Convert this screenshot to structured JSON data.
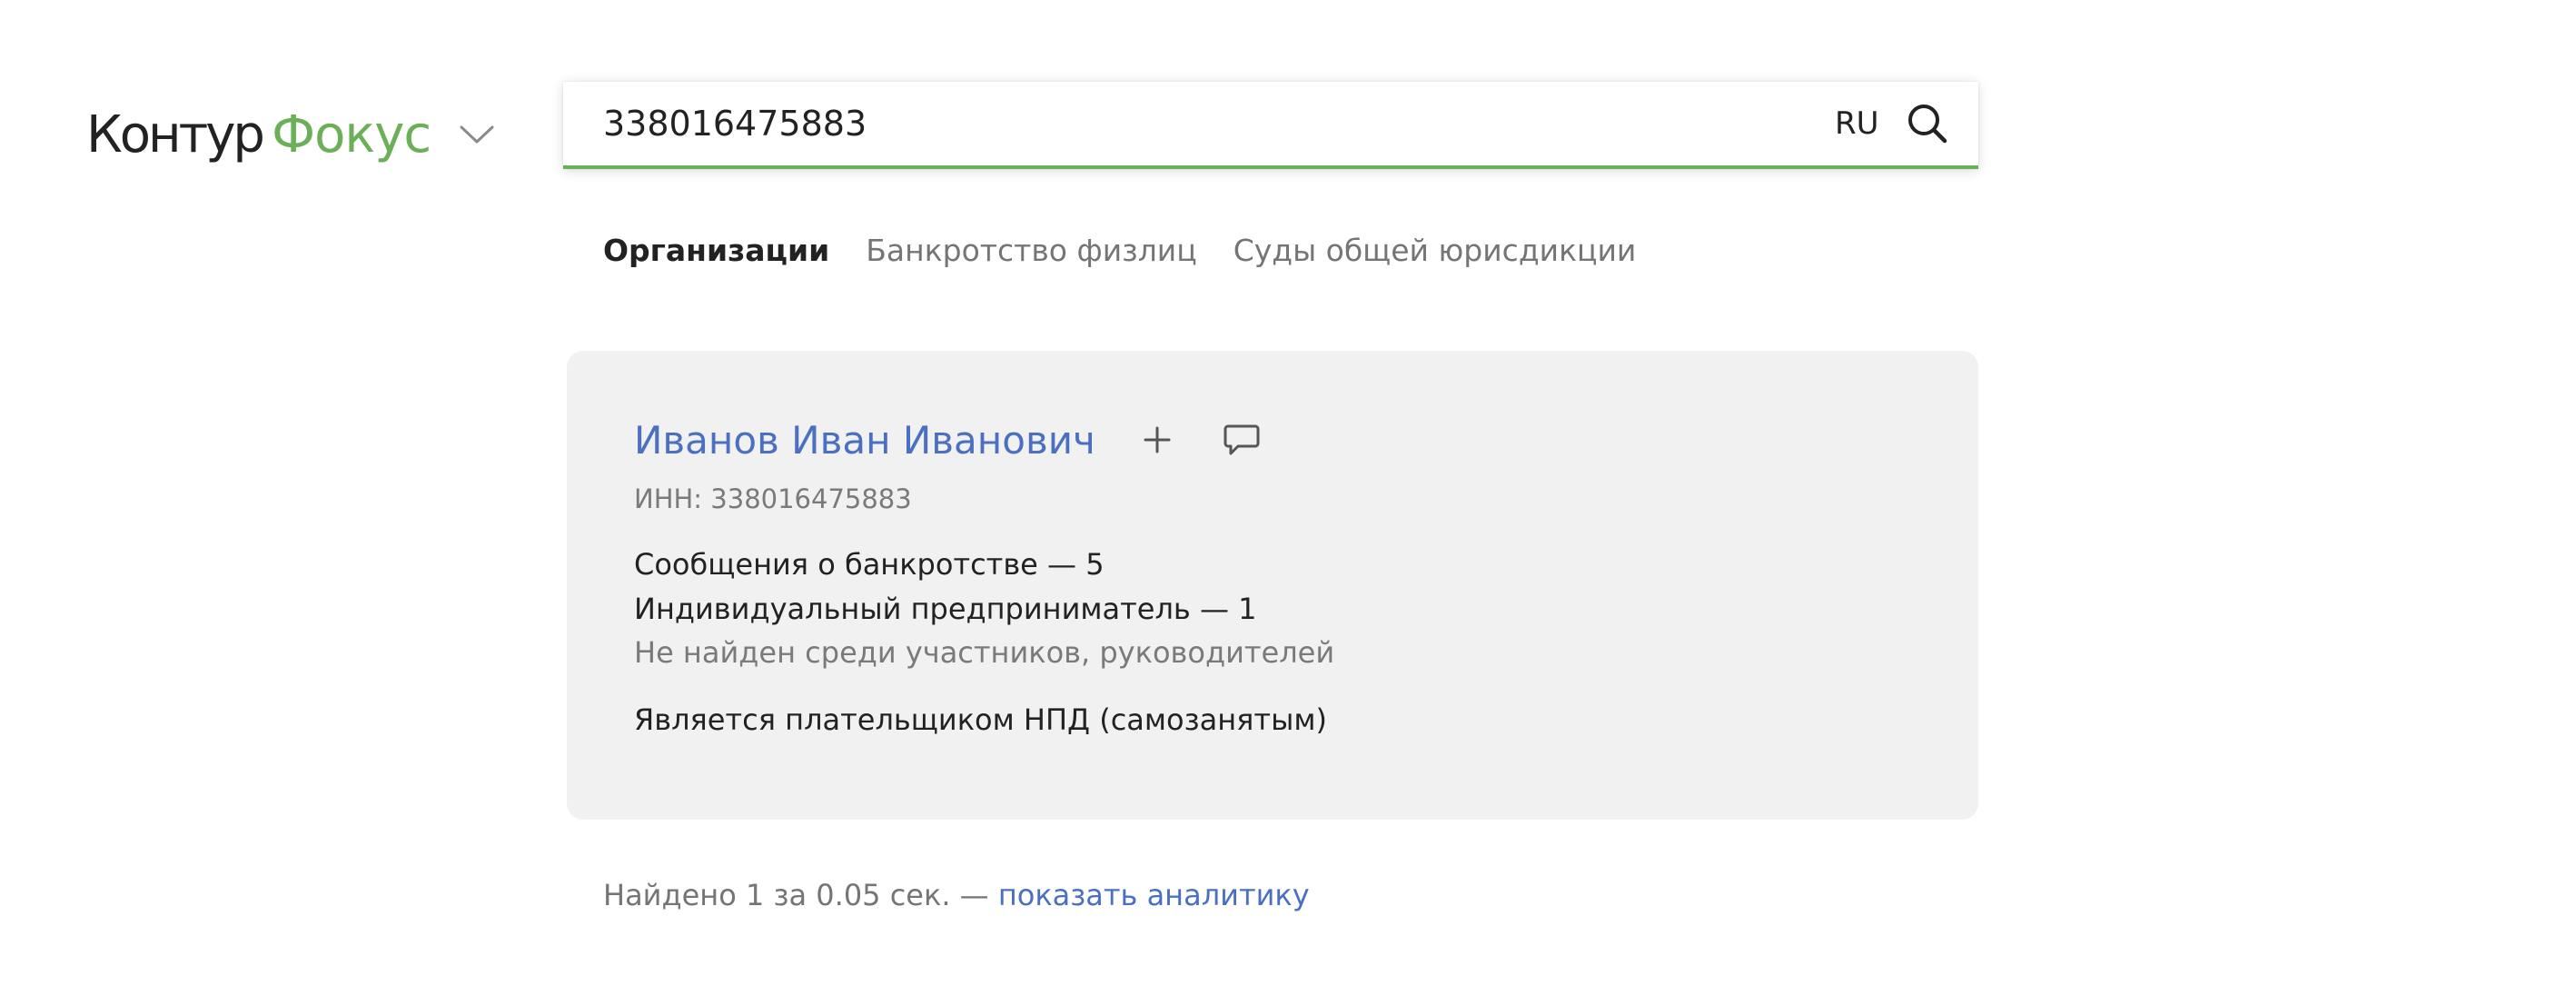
{
  "header": {
    "logo_part1": "Контур",
    "logo_part2": "Фокус",
    "logo_menu_icon": "chevron-down-icon",
    "brand_color": "#6bb059"
  },
  "search": {
    "value": "338016475883",
    "lang": "RU",
    "search_icon": "search-icon"
  },
  "tabs": [
    {
      "label": "Организации",
      "active": true
    },
    {
      "label": "Банкротство физлиц",
      "active": false
    },
    {
      "label": "Суды общей юрисдикции",
      "active": false
    }
  ],
  "result": {
    "name": "Иванов Иван Иванович",
    "add_icon": "plus-icon",
    "comment_icon": "comment-icon",
    "inn": "ИНН: 338016475883",
    "facts": [
      "Сообщения о банкротстве — 5",
      "Индивидуальный предприниматель — 1",
      "Не найден среди участников, руководителей",
      "Является плательщиком НПД (самозанятым)"
    ],
    "link_color": "#4b70c2"
  },
  "footer": {
    "found_text": "Найдено 1 за 0.05 сек. — ",
    "analytics_link": "показать аналитику"
  }
}
